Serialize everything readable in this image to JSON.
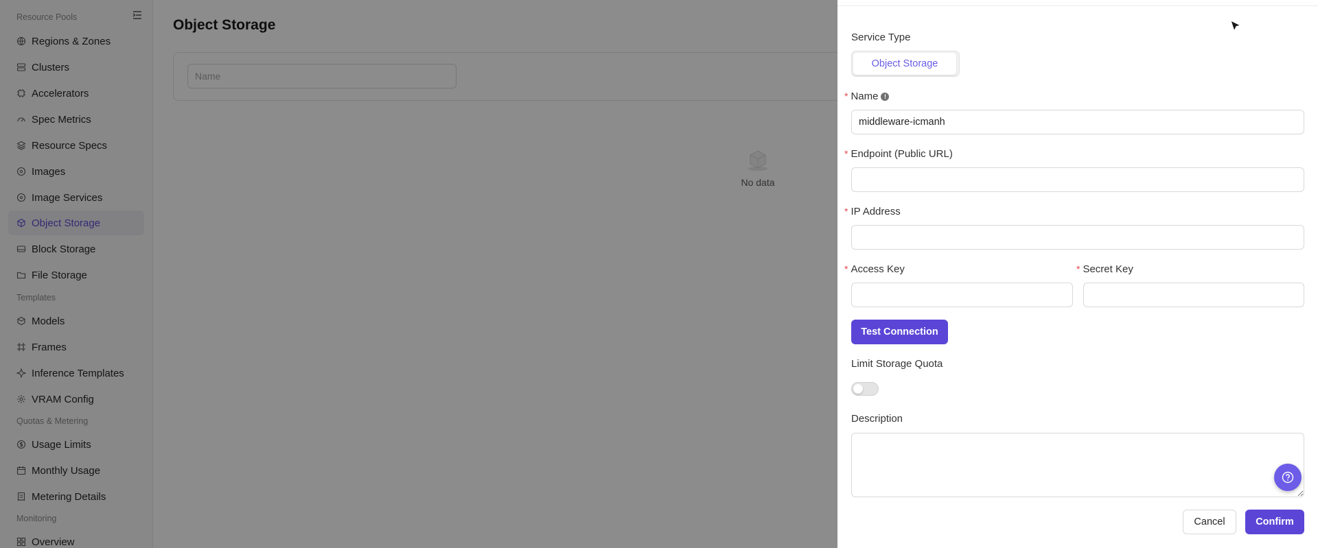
{
  "sidebar": {
    "sections": [
      {
        "label": "Resource Pools"
      },
      {
        "label": "Templates"
      },
      {
        "label": "Quotas & Metering"
      },
      {
        "label": "Monitoring"
      }
    ],
    "items": [
      {
        "label": "Regions & Zones",
        "icon": "globe-icon"
      },
      {
        "label": "Clusters",
        "icon": "server-icon"
      },
      {
        "label": "Accelerators",
        "icon": "chip-icon"
      },
      {
        "label": "Spec Metrics",
        "icon": "gauge-icon"
      },
      {
        "label": "Resource Specs",
        "icon": "stack-icon"
      },
      {
        "label": "Images",
        "icon": "disc-icon"
      },
      {
        "label": "Image Services",
        "icon": "disc-icon"
      },
      {
        "label": "Object Storage",
        "icon": "cube-icon",
        "active": true
      },
      {
        "label": "Block Storage",
        "icon": "drive-icon"
      },
      {
        "label": "File Storage",
        "icon": "folder-icon"
      },
      {
        "label": "Models",
        "icon": "box-icon"
      },
      {
        "label": "Frames",
        "icon": "frame-icon"
      },
      {
        "label": "Inference Templates",
        "icon": "sparkle-icon"
      },
      {
        "label": "VRAM Config",
        "icon": "gear-icon"
      },
      {
        "label": "Usage Limits",
        "icon": "coin-icon"
      },
      {
        "label": "Monthly Usage",
        "icon": "calendar-icon"
      },
      {
        "label": "Metering Details",
        "icon": "receipt-icon"
      },
      {
        "label": "Overview",
        "icon": "grid-icon"
      }
    ]
  },
  "main": {
    "title": "Object Storage",
    "filter": {
      "placeholder": "Name"
    },
    "empty_text": "No data"
  },
  "drawer": {
    "service_type": {
      "label": "Service Type",
      "selected": "Object Storage"
    },
    "name": {
      "label": "Name",
      "value": "middleware-icmanh"
    },
    "endpoint": {
      "label": "Endpoint (Public URL)",
      "value": ""
    },
    "ip": {
      "label": "IP Address",
      "value": ""
    },
    "access_key": {
      "label": "Access Key",
      "value": ""
    },
    "secret_key": {
      "label": "Secret Key",
      "value": ""
    },
    "test_button": "Test Connection",
    "quota": {
      "label": "Limit Storage Quota",
      "enabled": false
    },
    "description": {
      "label": "Description",
      "value": ""
    },
    "cancel": "Cancel",
    "confirm": "Confirm",
    "required_mark": "*",
    "info_glyph": "!"
  },
  "colors": {
    "accent": "#5b45d6",
    "accent_text": "#6c5ce7",
    "required": "#e5484d",
    "overlay": "rgba(0,0,0,0.45)"
  }
}
